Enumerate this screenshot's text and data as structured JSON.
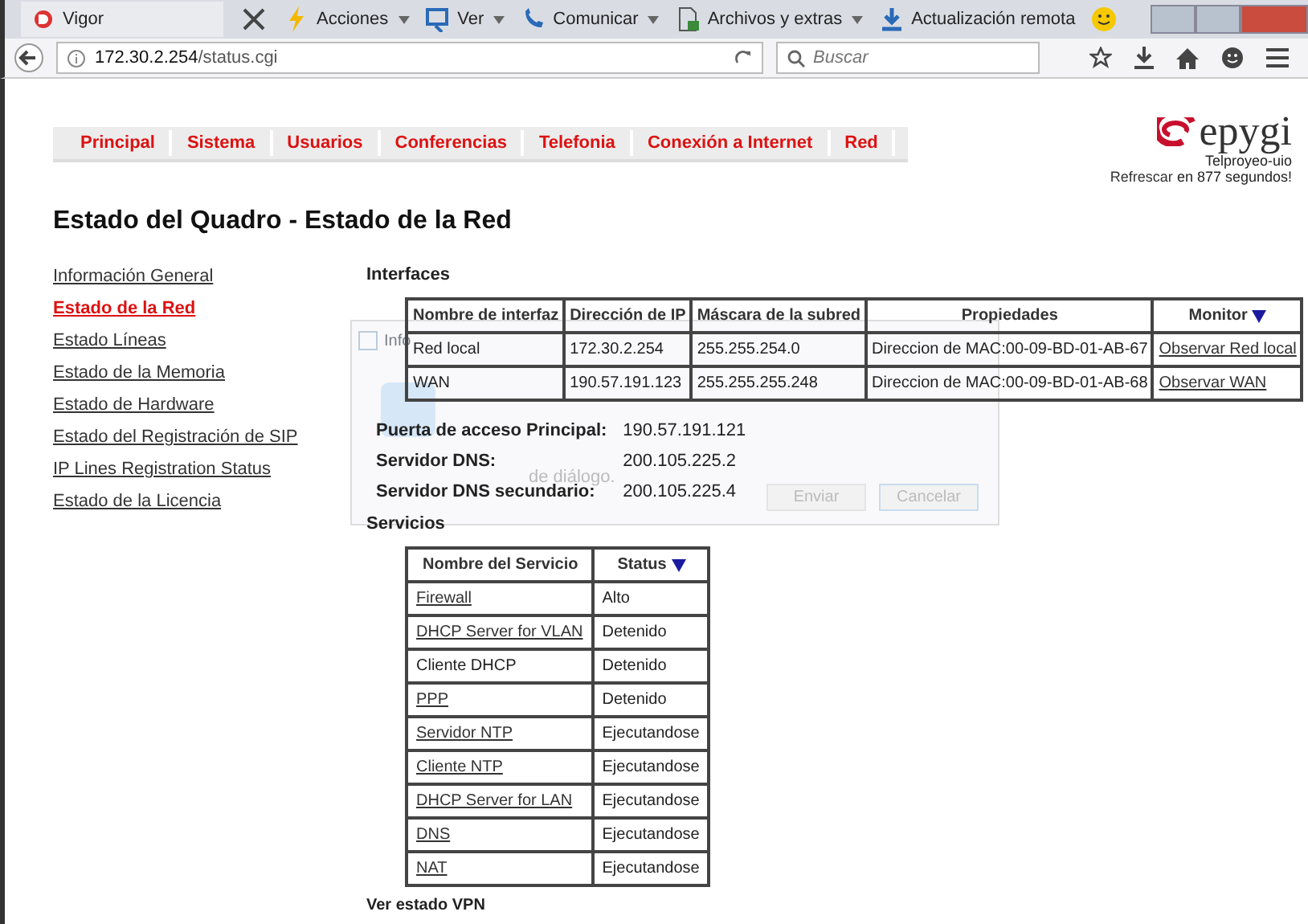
{
  "browser": {
    "tab_title": "Vigor",
    "toolbar_menus": [
      {
        "label": "Acciones",
        "dropdown": true
      },
      {
        "label": "Ver",
        "dropdown": true
      },
      {
        "label": "Comunicar",
        "dropdown": true
      },
      {
        "label": "Archivos y extras",
        "dropdown": true
      },
      {
        "label": "Actualización remota",
        "dropdown": false
      }
    ],
    "url_host": "172.30.2.254",
    "url_path": "/status.cgi",
    "search_placeholder": "Buscar"
  },
  "nav": [
    {
      "label": "Principal"
    },
    {
      "label": "Sistema"
    },
    {
      "label": "Usuarios"
    },
    {
      "label": "Conferencias"
    },
    {
      "label": "Telefonia"
    },
    {
      "label": "Conexión a Internet"
    },
    {
      "label": "Red"
    }
  ],
  "header": {
    "brand": "epygi",
    "device": "Telproyeo-uio",
    "refresh_link": "Refrescar",
    "refresh_text": "en 877 segundos!"
  },
  "page_title": "Estado del Quadro - Estado de la Red",
  "sidebar": [
    {
      "label": "Información General",
      "selected": false
    },
    {
      "label": "Estado de la Red",
      "selected": true
    },
    {
      "label": "Estado Líneas",
      "selected": false
    },
    {
      "label": "Estado de la Memoria",
      "selected": false
    },
    {
      "label": "Estado de Hardware",
      "selected": false
    },
    {
      "label": "Estado del Registración de SIP",
      "selected": false
    },
    {
      "label": "IP Lines Registration Status",
      "selected": false
    },
    {
      "label": "Estado de la Licencia",
      "selected": false
    }
  ],
  "interfaces": {
    "title": "Interfaces",
    "columns": [
      {
        "label": "Nombre de interfaz",
        "sorted": false
      },
      {
        "label": "Dirección de IP",
        "sorted": false
      },
      {
        "label": "Máscara de la subred",
        "sorted": false
      },
      {
        "label": "Propiedades",
        "sorted": false
      },
      {
        "label": "Monitor",
        "sorted": true
      }
    ],
    "rows": [
      {
        "name": "Red local",
        "ip": "172.30.2.254",
        "mask": "255.255.254.0",
        "mac_label": "Direccion de MAC:",
        "mac": "00-09-BD-01-AB-67",
        "monitor": "Observar Red local"
      },
      {
        "name": "WAN",
        "ip": "190.57.191.123",
        "mask": "255.255.255.248",
        "mac_label": "Direccion de MAC:",
        "mac": "00-09-BD-01-AB-68",
        "monitor": "Observar WAN"
      }
    ]
  },
  "network_info": [
    {
      "label": "Puerta de acceso Principal:",
      "value": "190.57.191.121"
    },
    {
      "label": "Servidor DNS:",
      "value": "200.105.225.2"
    },
    {
      "label": "Servidor DNS secundario:",
      "value": "200.105.225.4"
    }
  ],
  "services": {
    "title": "Servicios",
    "columns": [
      {
        "label": "Nombre del Servicio",
        "sorted": false
      },
      {
        "label": "Status",
        "sorted": true
      }
    ],
    "rows": [
      {
        "name": "Firewall",
        "link": true,
        "status": "Alto"
      },
      {
        "name": "DHCP Server for VLAN",
        "link": true,
        "status": "Detenido"
      },
      {
        "name": "Cliente DHCP",
        "link": false,
        "status": "Detenido"
      },
      {
        "name": "PPP",
        "link": true,
        "status": "Detenido"
      },
      {
        "name": "Servidor NTP",
        "link": true,
        "status": "Ejecutandose"
      },
      {
        "name": "Cliente NTP",
        "link": true,
        "status": "Ejecutandose"
      },
      {
        "name": "DHCP Server for LAN",
        "link": true,
        "status": "Ejecutandose"
      },
      {
        "name": "DNS",
        "link": true,
        "status": "Ejecutandose"
      },
      {
        "name": "NAT",
        "link": true,
        "status": "Ejecutandose"
      }
    ]
  },
  "dialog": {
    "title": "Info",
    "note": "de diálogo.",
    "buttons": [
      {
        "label": "Enviar"
      },
      {
        "label": "Cancelar"
      }
    ]
  },
  "vpn_heading": "Ver estado VPN"
}
